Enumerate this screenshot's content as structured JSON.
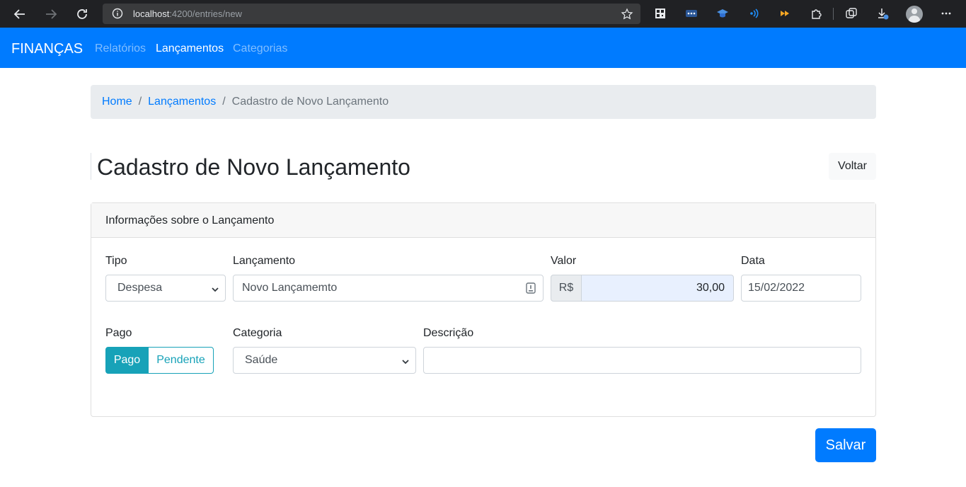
{
  "browser": {
    "url_host": "localhost",
    "url_path": ":4200/entries/new"
  },
  "navbar": {
    "brand": "FINANÇAS",
    "links": [
      "Relatórios",
      "Lançamentos",
      "Categorias"
    ],
    "active_link": "Lançamentos"
  },
  "breadcrumb": {
    "items": [
      "Home",
      "Lançamentos"
    ],
    "separator": "/",
    "current": "Cadastro de Novo Lançamento"
  },
  "page": {
    "title": "Cadastro de Novo Lançamento",
    "back_label": "Voltar"
  },
  "card": {
    "header": "Informações sobre o Lançamento",
    "fields": {
      "tipo": {
        "label": "Tipo",
        "value": "Despesa"
      },
      "lancamento": {
        "label": "Lançamento",
        "value": "Novo Lançamemto"
      },
      "valor": {
        "label": "Valor",
        "prefix": "R$",
        "value": "30,00"
      },
      "data": {
        "label": "Data",
        "value": "15/02/2022"
      },
      "pago": {
        "label": "Pago",
        "options": [
          "Pago",
          "Pendente"
        ],
        "selected": "Pago"
      },
      "categoria": {
        "label": "Categoria",
        "value": "Saúde"
      },
      "descricao": {
        "label": "Descrição",
        "value": ""
      }
    }
  },
  "actions": {
    "save_label": "Salvar"
  },
  "colors": {
    "primary": "#007bff",
    "info": "#17a2b8",
    "chrome_bg": "#202124"
  }
}
